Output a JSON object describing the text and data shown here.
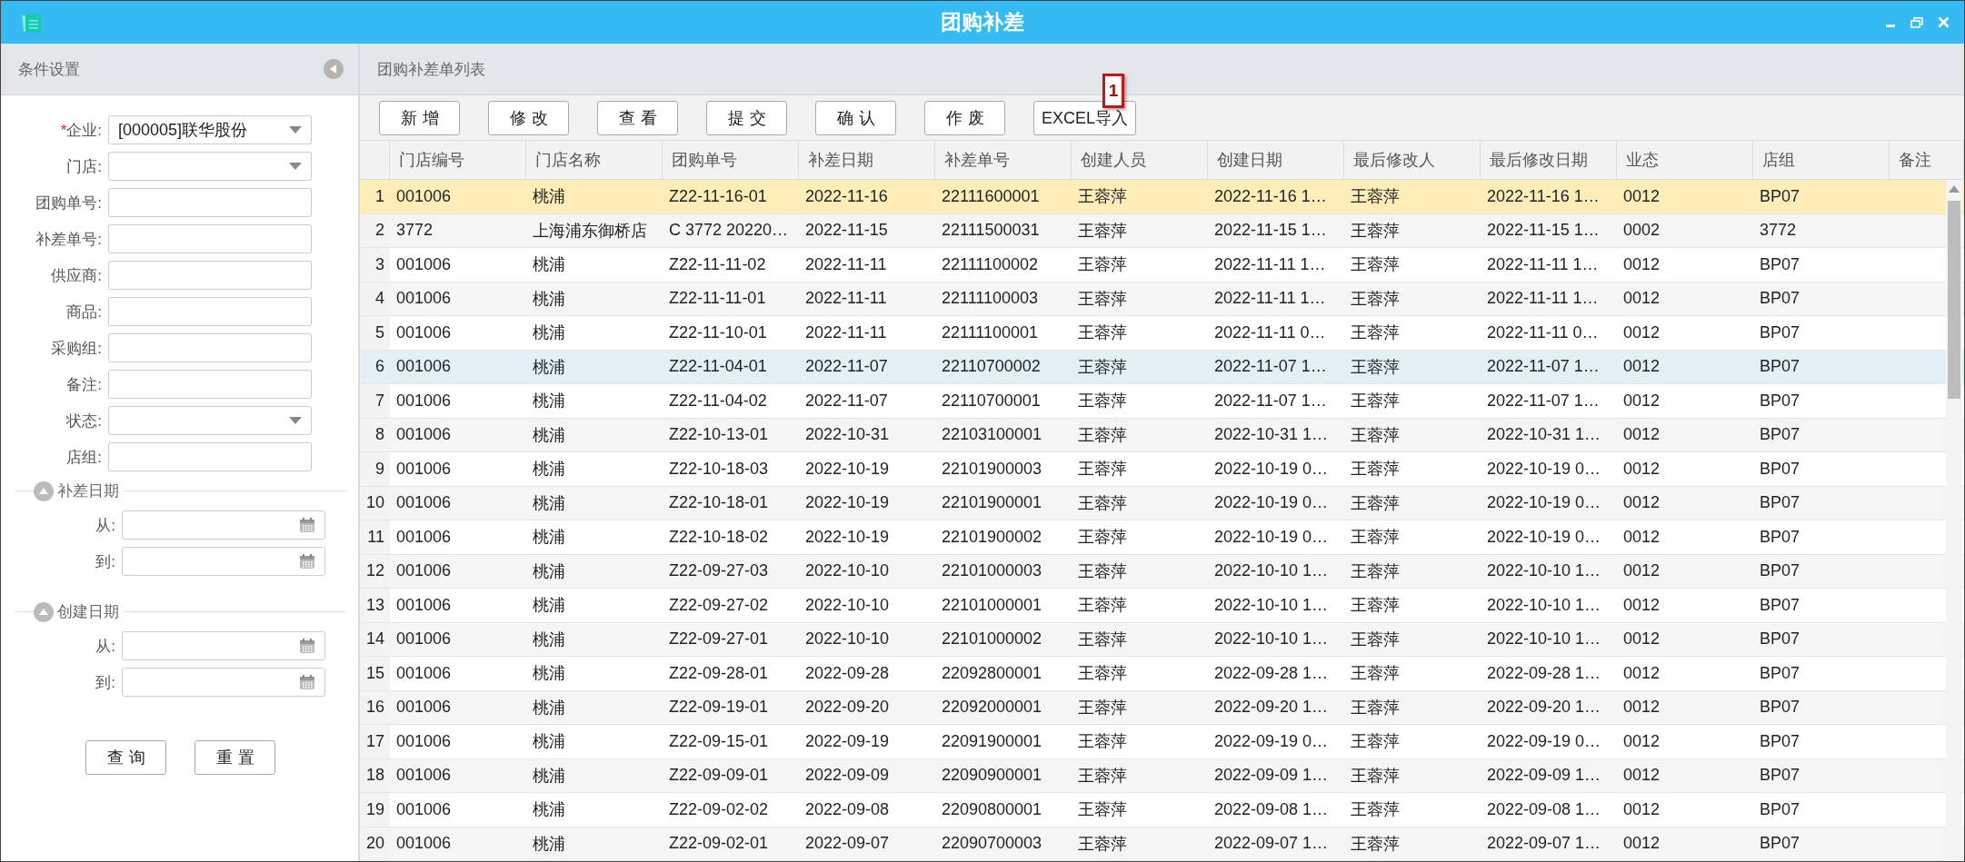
{
  "window": {
    "title": "团购补差"
  },
  "filter_panel": {
    "title": "条件设置",
    "fields": [
      {
        "label": "企业:",
        "kind": "select",
        "marker": "*",
        "value": "[000005]联华股份"
      },
      {
        "label": "门店:",
        "kind": "select"
      },
      {
        "label": "团购单号:",
        "kind": "text"
      },
      {
        "label": "补差单号:",
        "kind": "text"
      },
      {
        "label": "供应商:",
        "kind": "text"
      },
      {
        "label": "商品:",
        "kind": "text"
      },
      {
        "label": "采购组:",
        "kind": "text"
      },
      {
        "label": "备注:",
        "kind": "text"
      },
      {
        "label": "状态:",
        "kind": "select"
      },
      {
        "label": "店组:",
        "kind": "text"
      }
    ],
    "date_groups": [
      {
        "title": "补差日期",
        "expanded": true,
        "fields": [
          {
            "label": "从:"
          },
          {
            "label": "到:"
          }
        ]
      },
      {
        "title": "创建日期",
        "expanded": true,
        "fields": [
          {
            "label": "从:"
          },
          {
            "label": "到:"
          }
        ]
      }
    ],
    "buttons": [
      "查询",
      "重置"
    ]
  },
  "list_panel": {
    "title": "团购补差单列表",
    "toolbar": [
      {
        "label": "新增",
        "annotated": false
      },
      {
        "label": "修改",
        "annotated": false
      },
      {
        "label": "查看",
        "annotated": false
      },
      {
        "label": "提交",
        "annotated": false
      },
      {
        "label": "确认",
        "annotated": false
      },
      {
        "label": "作废",
        "annotated": false
      },
      {
        "label": "EXCEL导入",
        "annotated": true
      }
    ],
    "annotation": {
      "label": "1"
    },
    "table": {
      "columns": [
        "门店编号",
        "门店名称",
        "团购单号",
        "补差日期",
        "补差单号",
        "创建人员",
        "创建日期",
        "最后修改人",
        "最后修改日期",
        "业态",
        "店组",
        "备注"
      ],
      "rows": [
        {
          "no": "1",
          "selected": true,
          "hovered": false,
          "cells": [
            "001006",
            "桃浦",
            "Z22-11-16-01",
            "2022-11-16",
            "22111600001",
            "王蓉萍",
            "2022-11-16 1…",
            "王蓉萍",
            "2022-11-16 1…",
            "0012",
            "BP07"
          ]
        },
        {
          "no": "2",
          "selected": false,
          "hovered": false,
          "cells": [
            "3772",
            "上海浦东御桥店",
            "C 3772 20220…",
            "2022-11-15",
            "22111500031",
            "王蓉萍",
            "2022-11-15 1…",
            "王蓉萍",
            "2022-11-15 1…",
            "0002",
            "3772"
          ]
        },
        {
          "no": "3",
          "selected": false,
          "hovered": false,
          "cells": [
            "001006",
            "桃浦",
            "Z22-11-11-02",
            "2022-11-11",
            "22111100002",
            "王蓉萍",
            "2022-11-11 1…",
            "王蓉萍",
            "2022-11-11 1…",
            "0012",
            "BP07"
          ]
        },
        {
          "no": "4",
          "selected": false,
          "hovered": false,
          "cells": [
            "001006",
            "桃浦",
            "Z22-11-11-01",
            "2022-11-11",
            "22111100003",
            "王蓉萍",
            "2022-11-11 1…",
            "王蓉萍",
            "2022-11-11 1…",
            "0012",
            "BP07"
          ]
        },
        {
          "no": "5",
          "selected": false,
          "hovered": false,
          "cells": [
            "001006",
            "桃浦",
            "Z22-11-10-01",
            "2022-11-11",
            "22111100001",
            "王蓉萍",
            "2022-11-11 0…",
            "王蓉萍",
            "2022-11-11 0…",
            "0012",
            "BP07"
          ]
        },
        {
          "no": "6",
          "selected": false,
          "hovered": true,
          "cells": [
            "001006",
            "桃浦",
            "Z22-11-04-01",
            "2022-11-07",
            "22110700002",
            "王蓉萍",
            "2022-11-07 1…",
            "王蓉萍",
            "2022-11-07 1…",
            "0012",
            "BP07"
          ]
        },
        {
          "no": "7",
          "selected": false,
          "hovered": false,
          "cells": [
            "001006",
            "桃浦",
            "Z22-11-04-02",
            "2022-11-07",
            "22110700001",
            "王蓉萍",
            "2022-11-07 1…",
            "王蓉萍",
            "2022-11-07 1…",
            "0012",
            "BP07"
          ]
        },
        {
          "no": "8",
          "selected": false,
          "hovered": false,
          "cells": [
            "001006",
            "桃浦",
            "Z22-10-13-01",
            "2022-10-31",
            "22103100001",
            "王蓉萍",
            "2022-10-31 1…",
            "王蓉萍",
            "2022-10-31 1…",
            "0012",
            "BP07"
          ]
        },
        {
          "no": "9",
          "selected": false,
          "hovered": false,
          "cells": [
            "001006",
            "桃浦",
            "Z22-10-18-03",
            "2022-10-19",
            "22101900003",
            "王蓉萍",
            "2022-10-19 0…",
            "王蓉萍",
            "2022-10-19 0…",
            "0012",
            "BP07"
          ]
        },
        {
          "no": "10",
          "selected": false,
          "hovered": false,
          "cells": [
            "001006",
            "桃浦",
            "Z22-10-18-01",
            "2022-10-19",
            "22101900001",
            "王蓉萍",
            "2022-10-19 0…",
            "王蓉萍",
            "2022-10-19 0…",
            "0012",
            "BP07"
          ]
        },
        {
          "no": "11",
          "selected": false,
          "hovered": false,
          "cells": [
            "001006",
            "桃浦",
            "Z22-10-18-02",
            "2022-10-19",
            "22101900002",
            "王蓉萍",
            "2022-10-19 0…",
            "王蓉萍",
            "2022-10-19 0…",
            "0012",
            "BP07"
          ]
        },
        {
          "no": "12",
          "selected": false,
          "hovered": false,
          "cells": [
            "001006",
            "桃浦",
            "Z22-09-27-03",
            "2022-10-10",
            "22101000003",
            "王蓉萍",
            "2022-10-10 1…",
            "王蓉萍",
            "2022-10-10 1…",
            "0012",
            "BP07"
          ]
        },
        {
          "no": "13",
          "selected": false,
          "hovered": false,
          "cells": [
            "001006",
            "桃浦",
            "Z22-09-27-02",
            "2022-10-10",
            "22101000001",
            "王蓉萍",
            "2022-10-10 1…",
            "王蓉萍",
            "2022-10-10 1…",
            "0012",
            "BP07"
          ]
        },
        {
          "no": "14",
          "selected": false,
          "hovered": false,
          "cells": [
            "001006",
            "桃浦",
            "Z22-09-27-01",
            "2022-10-10",
            "22101000002",
            "王蓉萍",
            "2022-10-10 1…",
            "王蓉萍",
            "2022-10-10 1…",
            "0012",
            "BP07"
          ]
        },
        {
          "no": "15",
          "selected": false,
          "hovered": false,
          "cells": [
            "001006",
            "桃浦",
            "Z22-09-28-01",
            "2022-09-28",
            "22092800001",
            "王蓉萍",
            "2022-09-28 1…",
            "王蓉萍",
            "2022-09-28 1…",
            "0012",
            "BP07"
          ]
        },
        {
          "no": "16",
          "selected": false,
          "hovered": false,
          "cells": [
            "001006",
            "桃浦",
            "Z22-09-19-01",
            "2022-09-20",
            "22092000001",
            "王蓉萍",
            "2022-09-20 1…",
            "王蓉萍",
            "2022-09-20 1…",
            "0012",
            "BP07"
          ]
        },
        {
          "no": "17",
          "selected": false,
          "hovered": false,
          "cells": [
            "001006",
            "桃浦",
            "Z22-09-15-01",
            "2022-09-19",
            "22091900001",
            "王蓉萍",
            "2022-09-19 0…",
            "王蓉萍",
            "2022-09-19 0…",
            "0012",
            "BP07"
          ]
        },
        {
          "no": "18",
          "selected": false,
          "hovered": false,
          "cells": [
            "001006",
            "桃浦",
            "Z22-09-09-01",
            "2022-09-09",
            "22090900001",
            "王蓉萍",
            "2022-09-09 1…",
            "王蓉萍",
            "2022-09-09 1…",
            "0012",
            "BP07"
          ]
        },
        {
          "no": "19",
          "selected": false,
          "hovered": false,
          "cells": [
            "001006",
            "桃浦",
            "Z22-09-02-02",
            "2022-09-08",
            "22090800001",
            "王蓉萍",
            "2022-09-08 1…",
            "王蓉萍",
            "2022-09-08 1…",
            "0012",
            "BP07"
          ]
        },
        {
          "no": "20",
          "selected": false,
          "hovered": false,
          "cells": [
            "001006",
            "桃浦",
            "Z22-09-02-01",
            "2022-09-07",
            "22090700003",
            "王蓉萍",
            "2022-09-07 1…",
            "王蓉萍",
            "2022-09-07 1…",
            "0012",
            "BP07"
          ]
        }
      ]
    }
  }
}
